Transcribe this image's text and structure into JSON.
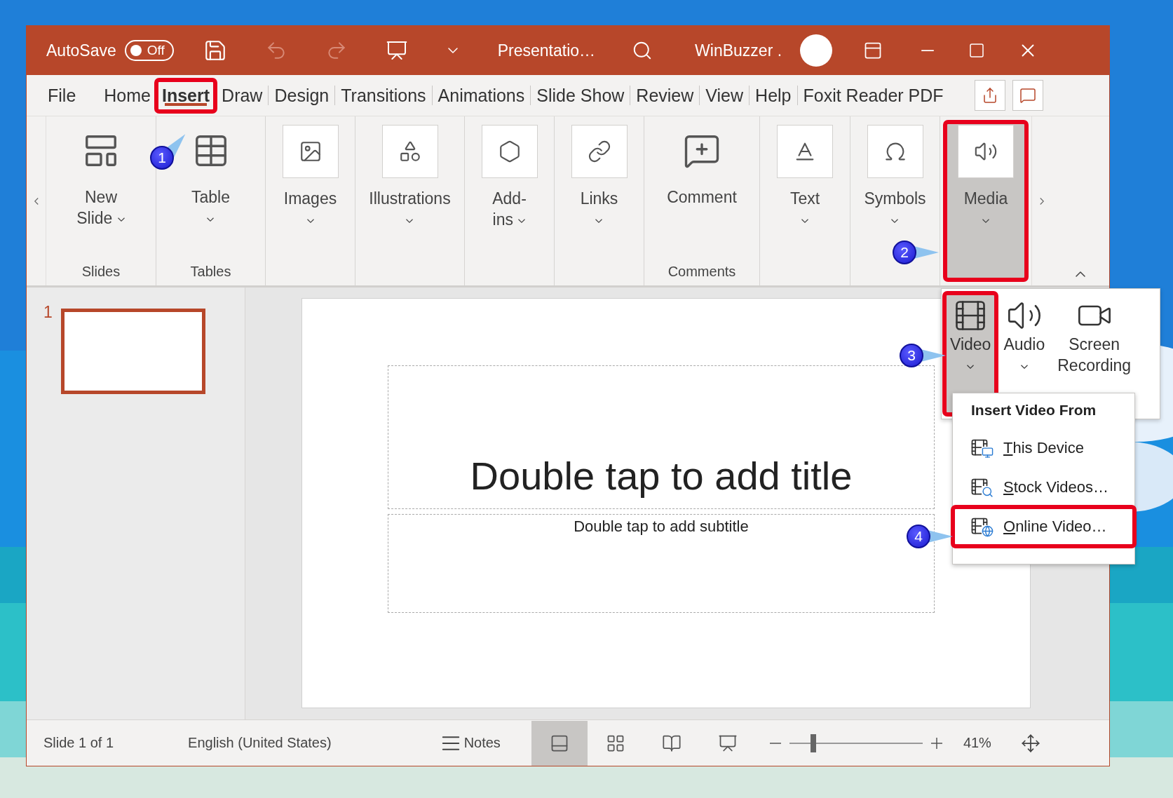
{
  "title_bar": {
    "autosave": {
      "label": "AutoSave",
      "toggle_text": "Off",
      "on": false
    },
    "document_title": "Presentatio…",
    "user_name": "WinBuzzer ."
  },
  "menu_tabs": [
    {
      "label": "File",
      "selected": false,
      "highlighted": false
    },
    {
      "label": "Home",
      "selected": false,
      "highlighted": false
    },
    {
      "label": "Insert",
      "selected": true,
      "highlighted": true
    },
    {
      "label": "Draw",
      "selected": false,
      "highlighted": false
    },
    {
      "label": "Design",
      "selected": false,
      "highlighted": false
    },
    {
      "label": "Transitions",
      "selected": false,
      "highlighted": false
    },
    {
      "label": "Animations",
      "selected": false,
      "highlighted": false
    },
    {
      "label": "Slide Show",
      "selected": false,
      "highlighted": false
    },
    {
      "label": "Review",
      "selected": false,
      "highlighted": false
    },
    {
      "label": "View",
      "selected": false,
      "highlighted": false
    },
    {
      "label": "Help",
      "selected": false,
      "highlighted": false
    },
    {
      "label": "Foxit Reader PDF",
      "selected": false,
      "highlighted": false
    }
  ],
  "ribbon_groups": [
    {
      "label": "Slides",
      "button": {
        "kind": "large",
        "lines": [
          "New",
          "Slide"
        ],
        "caret": true,
        "caret_beside_label": true,
        "selected": false,
        "highlighted": false
      }
    },
    {
      "label": "Tables",
      "button": {
        "kind": "large",
        "lines": [
          "Table"
        ],
        "caret": true,
        "caret_beside_label": false,
        "selected": false,
        "highlighted": false
      }
    },
    {
      "button": {
        "kind": "collapsed",
        "lines": [
          "Images"
        ],
        "caret": true,
        "caret_beside_label": false,
        "selected": false,
        "highlighted": false
      }
    },
    {
      "button": {
        "kind": "collapsed",
        "lines": [
          "Illustrations"
        ],
        "caret": true,
        "caret_beside_label": false,
        "selected": false,
        "highlighted": false
      }
    },
    {
      "button": {
        "kind": "collapsed",
        "lines": [
          "Add-",
          "ins"
        ],
        "caret": true,
        "caret_beside_label": true,
        "selected": false,
        "highlighted": false
      }
    },
    {
      "button": {
        "kind": "collapsed",
        "lines": [
          "Links"
        ],
        "caret": true,
        "caret_beside_label": false,
        "selected": false,
        "highlighted": false
      }
    },
    {
      "label": "Comments",
      "button": {
        "kind": "large",
        "lines": [
          "Comment"
        ],
        "caret": false,
        "selected": false,
        "highlighted": false
      }
    },
    {
      "button": {
        "kind": "collapsed",
        "lines": [
          "Text"
        ],
        "caret": true,
        "caret_beside_label": false,
        "selected": false,
        "highlighted": false
      }
    },
    {
      "button": {
        "kind": "collapsed",
        "lines": [
          "Symbols"
        ],
        "caret": true,
        "caret_beside_label": false,
        "selected": false,
        "highlighted": false
      }
    },
    {
      "button": {
        "kind": "collapsed",
        "lines": [
          "Media"
        ],
        "caret": true,
        "caret_beside_label": false,
        "selected": true,
        "highlighted": true
      }
    }
  ],
  "media_menu": {
    "items": [
      {
        "lines": [
          "Video"
        ],
        "caret": true,
        "selected": true,
        "highlighted": true
      },
      {
        "lines": [
          "Audio"
        ],
        "caret": true,
        "selected": false,
        "highlighted": false
      },
      {
        "lines": [
          "Screen",
          "Recording"
        ],
        "caret": false,
        "selected": false,
        "highlighted": false
      }
    ]
  },
  "video_menu": {
    "heading": "Insert Video From",
    "items": [
      {
        "key": "T",
        "rest": "his Device",
        "highlighted": false
      },
      {
        "key": "S",
        "rest": "tock Videos…",
        "highlighted": false
      },
      {
        "key": "O",
        "rest": "nline Video…",
        "highlighted": true
      }
    ]
  },
  "callouts": [
    {
      "number": "1"
    },
    {
      "number": "2"
    },
    {
      "number": "3"
    },
    {
      "number": "4"
    }
  ],
  "slides_pane": [
    {
      "number": "1",
      "selected": true
    }
  ],
  "slide": {
    "title_placeholder": "Double tap to add title",
    "subtitle_placeholder": "Double tap to add subtitle"
  },
  "status_bar": {
    "slide_position": "Slide 1 of 1",
    "language": "English (United States)",
    "notes": "Notes",
    "views": [
      {
        "selected": true
      },
      {
        "selected": false
      },
      {
        "selected": false
      },
      {
        "selected": false
      }
    ],
    "zoom": {
      "level": 0.18,
      "reading": "41%"
    }
  }
}
